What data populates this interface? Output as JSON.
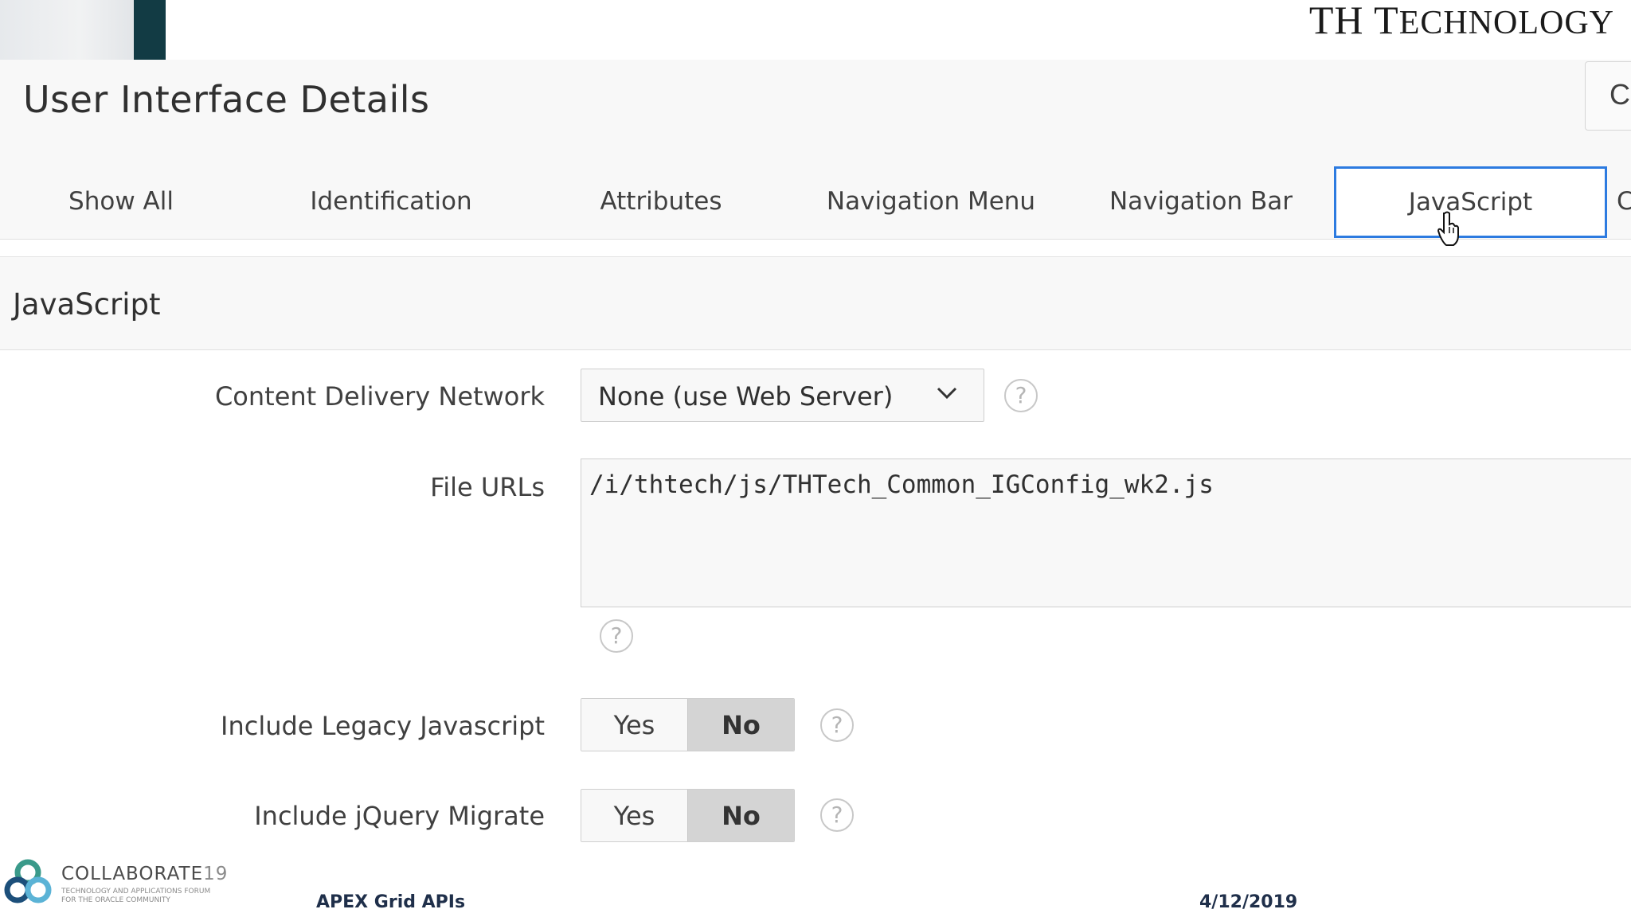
{
  "banner": {
    "brand_big_t": "TH T",
    "brand_rest": "ECHNOLOGY"
  },
  "header": {
    "title": "User Interface Details",
    "cancel_label": "Ca"
  },
  "tabs": [
    {
      "label": "Show All",
      "active": false
    },
    {
      "label": "Identification",
      "active": false
    },
    {
      "label": "Attributes",
      "active": false
    },
    {
      "label": "Navigation Menu",
      "active": false
    },
    {
      "label": "Navigation Bar",
      "active": false
    },
    {
      "label": "JavaScript",
      "active": true
    },
    {
      "label": "C",
      "active": false
    }
  ],
  "region": {
    "title": "JavaScript",
    "fields": {
      "cdn": {
        "label": "Content Delivery Network",
        "value": "None (use Web Server)"
      },
      "file_urls": {
        "label": "File URLs",
        "value": "/i/thtech/js/THTech_Common_IGConfig_wk2.js"
      },
      "legacy_js": {
        "label": "Include Legacy Javascript",
        "options": [
          "Yes",
          "No"
        ],
        "selected": "No"
      },
      "jquery_migrate": {
        "label": "Include jQuery Migrate",
        "options": [
          "Yes",
          "No"
        ],
        "selected": "No"
      }
    },
    "help_glyph": "?"
  },
  "footer": {
    "logo_name": "COLLABORATE",
    "logo_number": "19",
    "logo_tagline_1": "TECHNOLOGY AND APPLICATIONS FORUM",
    "logo_tagline_2": "FOR THE ORACLE COMMUNITY",
    "presentation_title": "APEX Grid APIs",
    "date": "4/12/2019"
  },
  "colors": {
    "active_tab_border": "#2d7be0",
    "banner_bar": "#123b44",
    "footer_text": "#1f2f4a"
  }
}
